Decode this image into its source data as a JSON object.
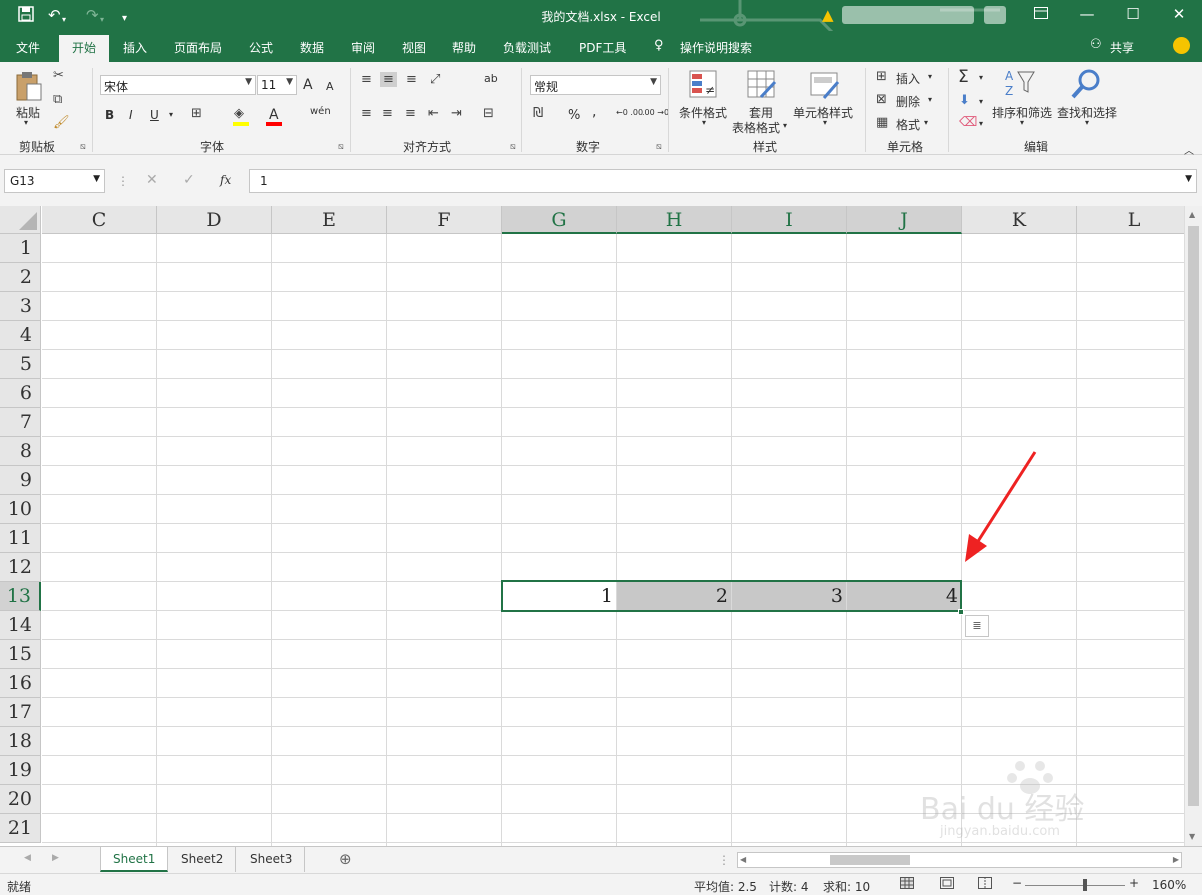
{
  "window": {
    "title": "我的文档.xlsx  -  Excel",
    "qa_icons": [
      "save-icon",
      "undo-icon",
      "redo-icon",
      "customize-icon"
    ],
    "controls": [
      "ribbon-display-icon",
      "minimize-icon",
      "maximize-icon",
      "close-icon"
    ]
  },
  "tabs": {
    "items": [
      "文件",
      "开始",
      "插入",
      "页面布局",
      "公式",
      "数据",
      "审阅",
      "视图",
      "帮助",
      "负载测试",
      "PDF工具"
    ],
    "active": "开始",
    "tell_me": "操作说明搜索",
    "share": "共享"
  },
  "ribbon": {
    "clipboard": {
      "paste": "粘贴",
      "label": "剪贴板"
    },
    "font": {
      "name": "宋体",
      "size": "11",
      "label": "字体",
      "bold": "B",
      "italic": "I",
      "underline": "U",
      "grow": "A",
      "shrink": "A",
      "color_a": "A",
      "wen": "wén",
      "fill_color": "#ffff00",
      "font_color": "#ff0000"
    },
    "alignment": {
      "label": "对齐方式",
      "wrap": "ab"
    },
    "number": {
      "format": "常规",
      "label": "数字",
      "percent": "%",
      "comma": ",",
      "inc": "←0 .00",
      "dec": ".00 →0"
    },
    "styles": {
      "conditional": "条件格式",
      "table_line1": "套用",
      "table_line2": "表格格式",
      "cell_styles": "单元格样式",
      "label": "样式"
    },
    "cells": {
      "insert": "插入",
      "delete": "删除",
      "format": "格式",
      "label": "单元格"
    },
    "editing": {
      "sum": "Σ",
      "sort": "排序和筛选",
      "find": "查找和选择",
      "label": "编辑"
    }
  },
  "formula_bar": {
    "name_box": "G13",
    "fx": "fx",
    "value": "1"
  },
  "grid": {
    "columns": [
      "C",
      "D",
      "E",
      "F",
      "G",
      "H",
      "I",
      "J",
      "K",
      "L"
    ],
    "selected_columns": [
      "G",
      "H",
      "I",
      "J"
    ],
    "rows": [
      "1",
      "2",
      "3",
      "4",
      "5",
      "6",
      "7",
      "8",
      "9",
      "10",
      "11",
      "12",
      "13",
      "14",
      "15",
      "16",
      "17",
      "18",
      "19",
      "20",
      "21"
    ],
    "selected_row": "13",
    "row13_values": {
      "G": "1",
      "H": "2",
      "I": "3",
      "J": "4"
    }
  },
  "sheets": {
    "tabs": [
      "Sheet1",
      "Sheet2",
      "Sheet3"
    ],
    "active": "Sheet1"
  },
  "status": {
    "ready": "就绪",
    "average": "平均值: 2.5",
    "count": "计数: 4",
    "sum": "求和: 10",
    "zoom": "160%",
    "minus": "−",
    "plus": "+"
  },
  "watermark": {
    "text": "Bai du 经验",
    "url": "jingyan.baidu.com"
  },
  "accent": "#217346"
}
